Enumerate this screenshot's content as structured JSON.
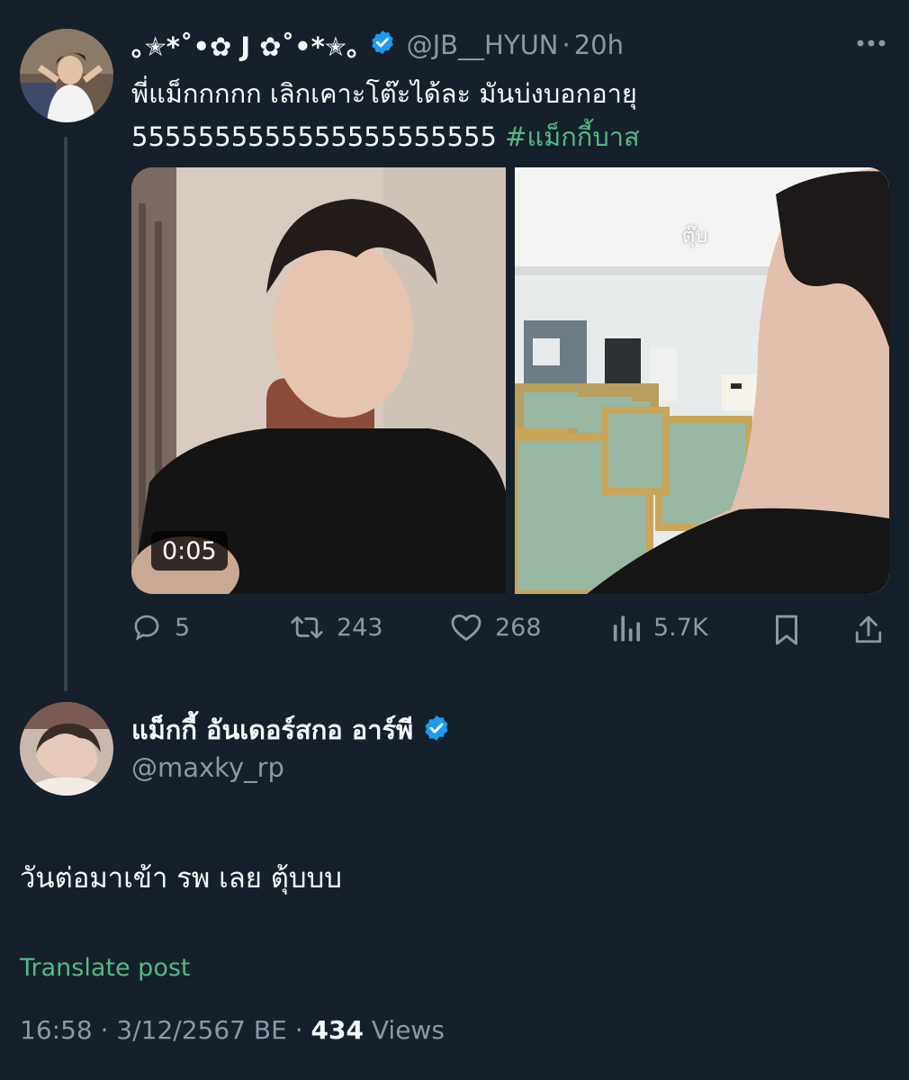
{
  "quoted_post": {
    "display_name": "｡✭*˚•✿ J ✿˚•*✭｡",
    "handle": "@JB__HYUN",
    "separator": "·",
    "time_ago": "20h",
    "text_line1": "พี่แม็กกกกก เลิกเคาะโต๊ะได้ละ มันบ่งบอกอายุ",
    "text_line2_plain": "5555555555555555555555",
    "hashtag": "#แม็กกี้บาส",
    "video_duration": "0:05",
    "overlay_caption": "ตุ๊บ",
    "actions": {
      "replies": "5",
      "reposts": "243",
      "likes": "268",
      "views": "5.7K"
    }
  },
  "main_post": {
    "display_name": "แม็กกี้ อันเดอร์สกอ อาร์พี",
    "handle": "@maxky_rp",
    "text": "วันต่อมาเข้า รพ เลย ตุ้บบบ",
    "translate_label": "Translate post",
    "meta_time": "16:58",
    "meta_sep1": "·",
    "meta_date": "3/12/2567 BE",
    "meta_sep2": "·",
    "views_count": "434",
    "views_label": "Views"
  },
  "colors": {
    "background": "#15202b",
    "text": "#f7f9f9",
    "muted": "#8b98a5",
    "hashtag": "#55b883",
    "verified": "#1d9bf0"
  }
}
